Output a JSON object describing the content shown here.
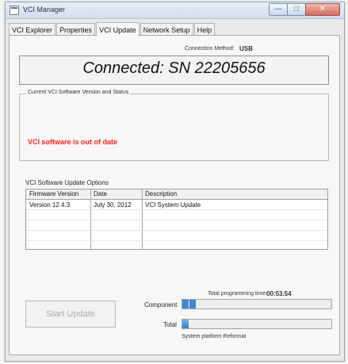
{
  "window": {
    "title": "VCI Manager",
    "controls": {
      "minimize": "—",
      "maximize": "□",
      "close": "✕"
    }
  },
  "tabs": [
    {
      "label": "VCI Explorer"
    },
    {
      "label": "Properties"
    },
    {
      "label": "VCI Update"
    },
    {
      "label": "Network Setup"
    },
    {
      "label": "Help"
    }
  ],
  "connection": {
    "label": "Connection Method:",
    "value": "USB",
    "status": "Connected: SN 22205656"
  },
  "status_group": {
    "title": "Current VCI Software Version and Status",
    "message": "VCI software is out of date"
  },
  "update_options": {
    "title": "VCI Software Update Options",
    "columns": [
      "Firmware Version",
      "Date",
      "Description"
    ],
    "rows": [
      [
        "Version 12.4.3",
        "July 30, 2012",
        "VCI System Update"
      ]
    ]
  },
  "progress": {
    "total_time_label": "Total programming time:",
    "total_time_value": "00:53.54",
    "component_label": "Component",
    "component_fraction": 0.09,
    "total_label": "Total",
    "total_fraction": 0.04,
    "status": "System platform Reformat"
  },
  "actions": {
    "start_update": "Start Update"
  },
  "icons": {
    "app": "app-icon",
    "minimize": "minimize-icon",
    "maximize": "maximize-icon",
    "close": "close-icon"
  },
  "colors": {
    "error": "#ff1f1f",
    "progress": "#2d82d0",
    "close_button": "#d36d5f"
  }
}
